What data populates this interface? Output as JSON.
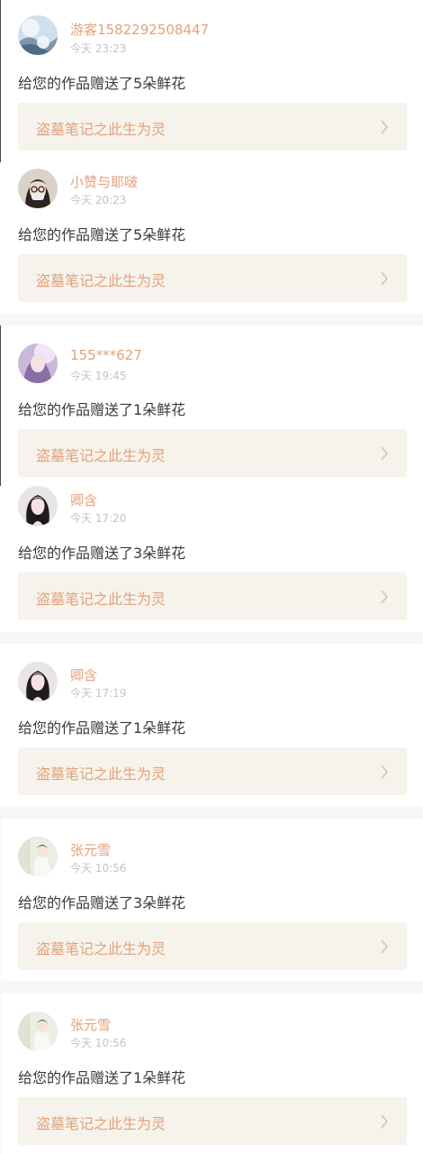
{
  "colors": {
    "accent": "#e2a27a",
    "card_bg": "#ffffff",
    "work_box_bg": "#f6f3ec",
    "divider_bg": "#f7f7f7",
    "time_gray": "#c4c4c4",
    "text_dark": "#3a3a3a"
  },
  "items": [
    {
      "name": "游客1582292508447",
      "time": "今天 23:23",
      "message": "给您的作品赠送了5朵鲜花",
      "work_title": "盗墓笔记之此生为灵",
      "avatar": "landscape-avatar-icon"
    },
    {
      "name": "小赞与耶啵",
      "time": "今天 20:23",
      "message": "给您的作品赠送了5朵鲜花",
      "work_title": "盗墓笔记之此生为灵",
      "avatar": "glasses-girl-avatar-icon"
    },
    {
      "name": "155***627",
      "time": "今天 19:45",
      "message": "给您的作品赠送了1朵鲜花",
      "work_title": "盗墓笔记之此生为灵",
      "avatar": "purple-portrait-avatar-icon"
    },
    {
      "name": "卿含",
      "time": "今天 17:20",
      "message": "给您的作品赠送了3朵鲜花",
      "work_title": "盗墓笔记之此生为灵",
      "avatar": "long-hair-girl-avatar-icon"
    },
    {
      "name": "卿含",
      "time": "今天 17:19",
      "message": "给您的作品赠送了1朵鲜花",
      "work_title": "盗墓笔记之此生为灵",
      "avatar": "long-hair-girl-avatar-icon"
    },
    {
      "name": "张元雪",
      "time": "今天 10:56",
      "message": "给您的作品赠送了3朵鲜花",
      "work_title": "盗墓笔记之此生为灵",
      "avatar": "pale-portrait-avatar-icon"
    },
    {
      "name": "张元雪",
      "time": "今天 10:56",
      "message": "给您的作品赠送了1朵鲜花",
      "work_title": "盗墓笔记之此生为灵",
      "avatar": "pale-portrait-avatar-icon"
    }
  ]
}
